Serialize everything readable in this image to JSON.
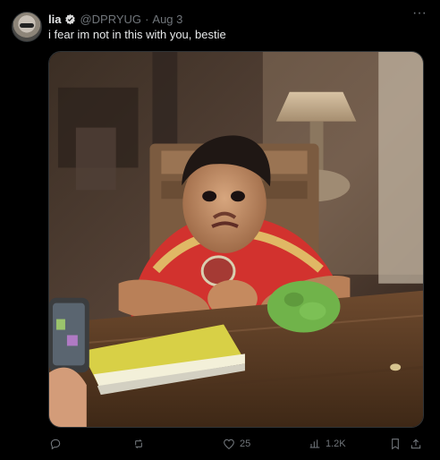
{
  "tweet": {
    "display_name": "lia",
    "handle": "@DPRYUG",
    "dot": "·",
    "date": "Aug 3",
    "text": "i fear im not in this with you, bestie"
  },
  "actions": {
    "reply_count": "",
    "retweet_count": "",
    "like_count": "25",
    "views_count": "1.2K"
  },
  "icons": {
    "avatar": "avatar",
    "verified": "verified-badge-icon",
    "more": "more-icon",
    "reply": "reply-icon",
    "retweet": "retweet-icon",
    "like": "heart-icon",
    "views": "views-icon",
    "bookmark": "bookmark-icon",
    "share": "share-icon"
  },
  "colors": {
    "background": "#000000",
    "text": "#e7e9ea",
    "muted": "#71767b",
    "border": "#2f3336"
  }
}
